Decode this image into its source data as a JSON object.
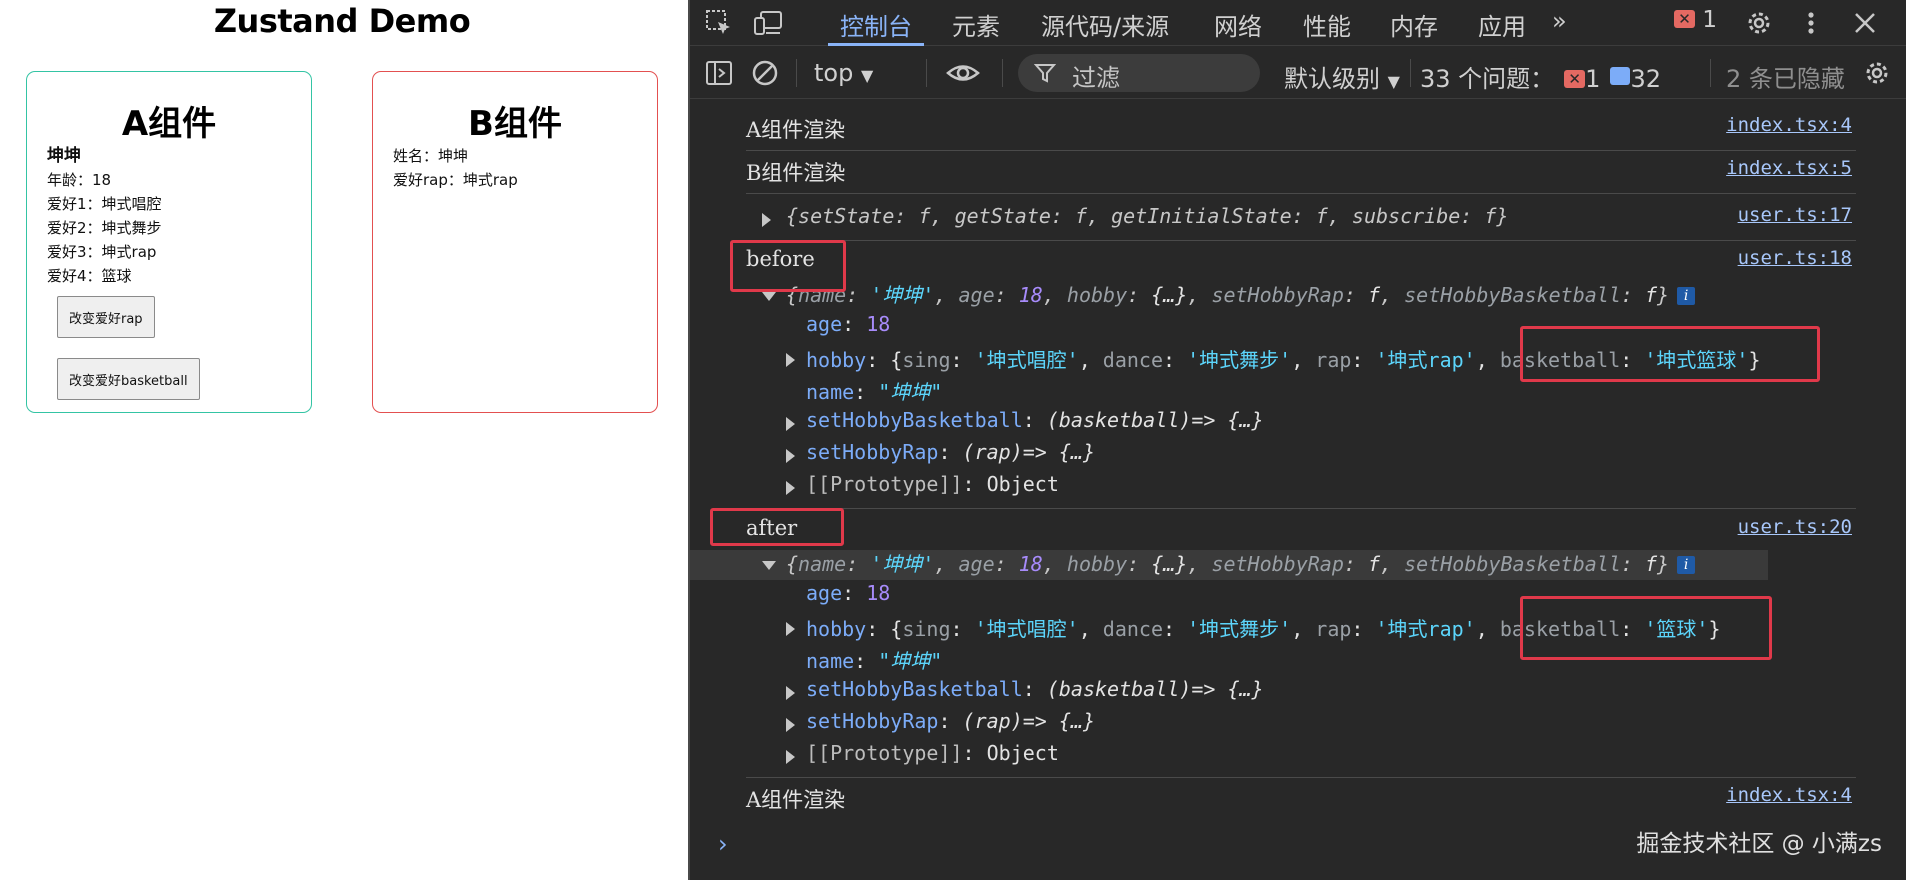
{
  "app": {
    "title": "Zustand Demo",
    "card_a": {
      "title": "A组件",
      "name": "坤坤",
      "age_line": "年龄：18",
      "hobby1_line": "爱好1：坤式唱腔",
      "hobby2_line": "爱好2：坤式舞步",
      "hobby3_line": "爱好3：坤式rap",
      "hobby4_line": "爱好4：篮球",
      "btn_rap": "改变爱好rap",
      "btn_basketball": "改变爱好basketball",
      "border_color": "#34c4a4"
    },
    "card_b": {
      "title": "B组件",
      "name_line": "姓名：坤坤",
      "rap_line": "爱好rap：坤式rap",
      "border_color": "#e35050"
    }
  },
  "devtools": {
    "tabs": [
      "控制台",
      "元素",
      "源代码/来源",
      "网络",
      "性能",
      "内存",
      "应用"
    ],
    "more": "»",
    "error_count": "1",
    "toolbar": {
      "context": "top",
      "filter_placeholder": "过滤",
      "levels": "默认级别",
      "issues_label": "33 个问题：",
      "issues_errors": "1",
      "issues_messages": "32",
      "hidden": "2 条已隐藏"
    },
    "console": {
      "log1": {
        "text": "A组件渲染",
        "src": "index.tsx:4"
      },
      "log2": {
        "text": "B组件渲染",
        "src": "index.tsx:5"
      },
      "log3": {
        "text": "{setState: f, getState: f, getInitialState: f, subscribe: f}",
        "src": "user.ts:17"
      },
      "before": {
        "label": "before",
        "src": "user.ts:18",
        "preview": {
          "name": "'坤坤'",
          "age": "18",
          "hobby": "{…}",
          "setHobbyRap": "f",
          "setHobbyBasketball": "f"
        },
        "age": "18",
        "hobby": {
          "sing": "'坤式唱腔'",
          "dance": "'坤式舞步'",
          "rap": "'坤式rap'",
          "basketball": "'坤式篮球'"
        },
        "name": "\"坤坤\"",
        "setHobbyBasketball": "(basketball)=> {…}",
        "setHobbyRap": "(rap)=> {…}",
        "prototype": "Object"
      },
      "after": {
        "label": "after",
        "src": "user.ts:20",
        "preview": {
          "name": "'坤坤'",
          "age": "18",
          "hobby": "{…}",
          "setHobbyRap": "f",
          "setHobbyBasketball": "f"
        },
        "age": "18",
        "hobby": {
          "sing": "'坤式唱腔'",
          "dance": "'坤式舞步'",
          "rap": "'坤式rap'",
          "basketball": "'篮球'"
        },
        "name": "\"坤坤\"",
        "setHobbyBasketball": "(basketball)=> {…}",
        "setHobbyRap": "(rap)=> {…}",
        "prototype": "Object"
      },
      "log_last": {
        "text": "A组件渲染",
        "src": "index.tsx:4"
      },
      "prompt": "›"
    },
    "watermark": "掘金技术社区 @ 小满zs"
  },
  "colors": {
    "devtools_bg": "#282828",
    "link": "#a8c7fa",
    "active_tab": "#8ab4f8",
    "highlight_box": "#e0394a",
    "string": "#5cd5fb",
    "property": "#7cacf8"
  }
}
